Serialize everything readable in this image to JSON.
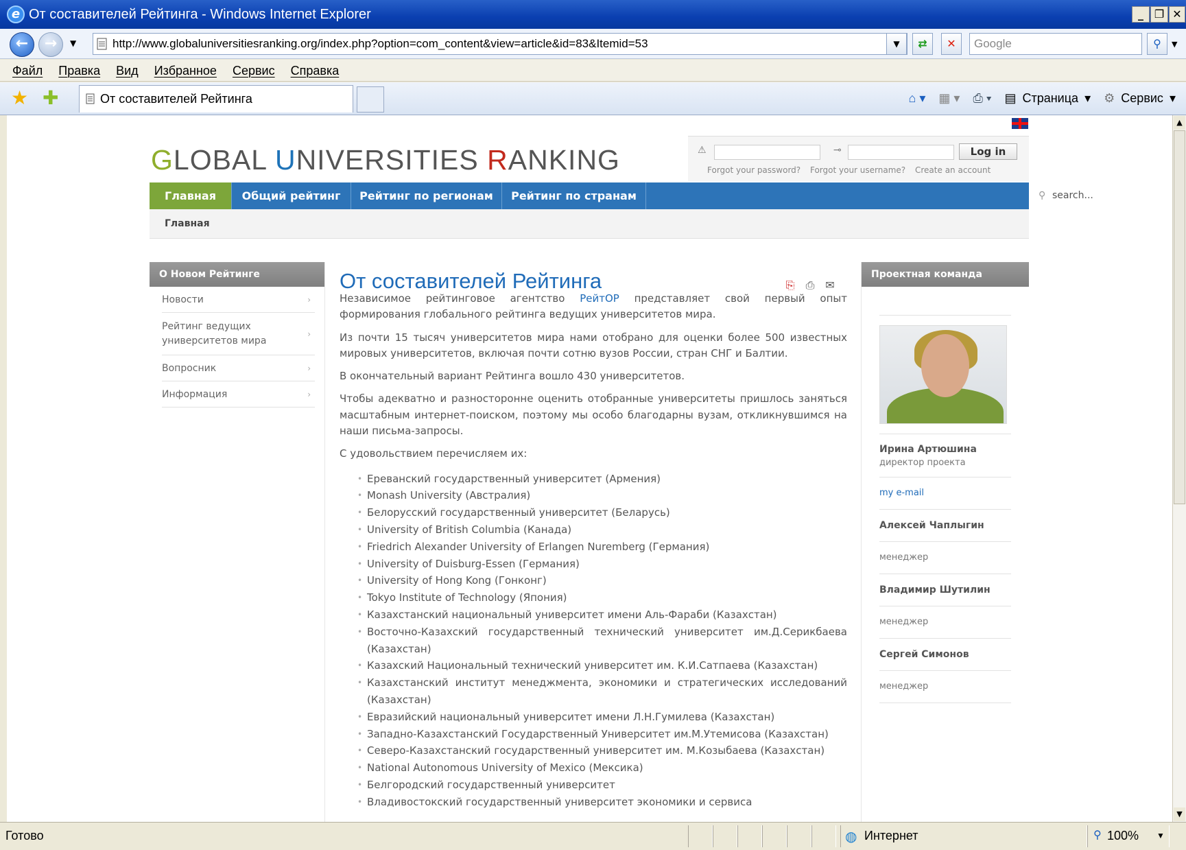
{
  "window": {
    "title": "От составителей Рейтинга - Windows Internet Explorer",
    "url": "http://www.globaluniversitiesranking.org/index.php?option=com_content&view=article&id=83&Itemid=53",
    "search_placeholder": "Google"
  },
  "menu": [
    "Файл",
    "Правка",
    "Вид",
    "Избранное",
    "Сервис",
    "Справка"
  ],
  "tab": {
    "label": "От составителей Рейтинга"
  },
  "commandbar": {
    "page_label": "Страница",
    "tools_label": "Сервис"
  },
  "statusbar": {
    "status": "Готово",
    "zone": "Интернет",
    "zoom": "100%"
  },
  "site": {
    "logo": {
      "g": "G",
      "lobal": "LOBAL ",
      "u": "U",
      "niversities": "NIVERSITIES ",
      "r": "R",
      "anking": "ANKING"
    },
    "login": {
      "button": "Log in",
      "links": [
        "Forgot your password?",
        "Forgot your username?",
        "Create an account"
      ]
    },
    "nav": [
      "Главная",
      "Общий рейтинг",
      "Рейтинг по регионам",
      "Рейтинг по странам"
    ],
    "search_placeholder": "search...",
    "breadcrumb": "Главная"
  },
  "left": {
    "heading": "О Новом Рейтинге",
    "items": [
      "Новости",
      "Рейтинг ведущих университетов мира",
      "Вопросник",
      "Информация"
    ]
  },
  "article": {
    "title": "От составителей Рейтинга",
    "p1_pre": "Независимое рейтинговое агентство ",
    "p1_link": "РейтОР",
    "p1_post": " представляет свой первый опыт формирования глобального рейтинга ведущих университетов мира.",
    "p2": "Из почти 15 тысяч университетов мира нами отобрано для оценки более 500 известных мировых университетов, включая почти сотню вузов России, стран СНГ и Балтии.",
    "p3": "В окончательный вариант Рейтинга вошло 430 университетов.",
    "p4": "Чтобы адекватно и разносторонне оценить отобранные университеты пришлось заняться масштабным интернет-поиском, поэтому мы особо благодарны вузам, откликнувшимся на наши письма-запросы.",
    "p5": "С удовольствием перечисляем их:",
    "universities": [
      "Ереванский государственный университет (Армения)",
      "Monash University (Австралия)",
      "Белорусский государственный университет (Беларусь)",
      "University of British Columbia (Канада)",
      "Friedrich Alexander University of Erlangen Nuremberg (Германия)",
      "University of Duisburg-Essen (Германия)",
      "University of Hong Kong (Гонконг)",
      "Tokyo Institute of Technology (Япония)",
      "Казахстанский национальный университет имени Аль-Фараби (Казахстан)",
      "Восточно-Казахский государственный технический университет им.Д.Серикбаева (Казахстан)",
      "Казахский Национальный технический университет им. К.И.Сатпаева (Казахстан)",
      "Казахстанский институт менеджмента, экономики и стратегических исследований (Казахстан)",
      "Евразийский национальный университет имени Л.Н.Гумилева (Казахстан)",
      "Западно-Казахстанский Государственный Университет им.М.Утемисова (Казахстан)",
      "Северо-Казахстанский государственный университет им. М.Козыбаева (Казахстан)",
      "National Autonomous University of Mexico (Мексика)",
      "Белгородский государственный университет",
      "Владивостокский государственный университет экономики и сервиса"
    ]
  },
  "right": {
    "heading": "Проектная команда",
    "team": [
      {
        "name": "Ирина Артюшина",
        "role": "директор проекта",
        "mail": "my e-mail"
      },
      {
        "name": "Алексей Чаплыгин",
        "role": "менеджер"
      },
      {
        "name": "Владимир Шутилин",
        "role": "менеджер"
      },
      {
        "name": "Сергей Симонов",
        "role": "менеджер"
      }
    ]
  }
}
